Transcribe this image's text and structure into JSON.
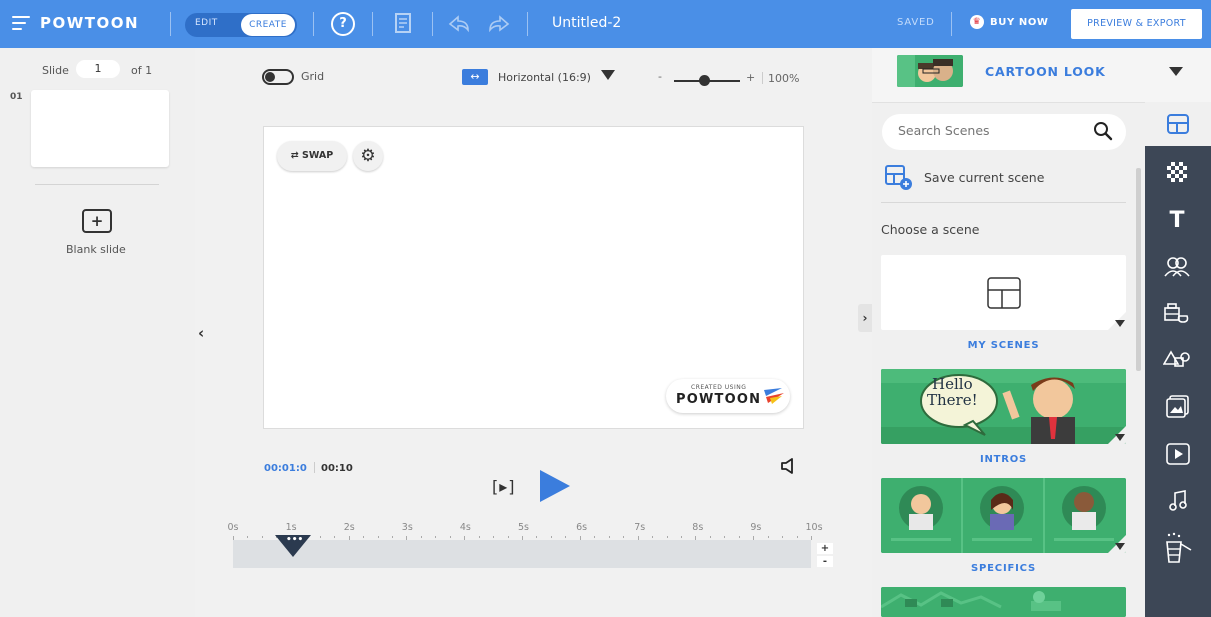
{
  "topbar": {
    "logo": "POWTOON",
    "mode_edit": "EDIT",
    "mode_create": "CREATE",
    "help": "?",
    "doc_title": "Untitled-2",
    "saved": "SAVED",
    "buy_now": "BUY NOW",
    "preview_export": "PREVIEW & EXPORT"
  },
  "slides": {
    "label": "Slide",
    "current": "1",
    "of": "of 1",
    "index": "01",
    "blank_label": "Blank slide"
  },
  "canvas_toolbar": {
    "grid_label": "Grid",
    "orientation": "Horizontal (16:9)",
    "zoom_minus": "-",
    "zoom_plus": "+",
    "zoom_value": "100%",
    "zoom_level": 0.45
  },
  "stage": {
    "swap_label": "SWAP",
    "watermark_small": "CREATED USING",
    "watermark_big": "POWTOON"
  },
  "playback": {
    "current_time": "00:01:0",
    "total_time": "00:10",
    "play_scene": "[▸]",
    "ticks": [
      "0s",
      "1s",
      "2s",
      "3s",
      "4s",
      "5s",
      "6s",
      "7s",
      "8s",
      "9s",
      "10s"
    ],
    "playhead_dots": "•••",
    "zoom_in": "+",
    "zoom_out": "-"
  },
  "right_panel": {
    "look_label": "CARTOON LOOK",
    "search_placeholder": "Search Scenes",
    "save_scene": "Save current scene",
    "choose_scene": "Choose a scene",
    "scenes": [
      "MY SCENES",
      "INTROS",
      "SPECIFICS"
    ],
    "intro_bubble_1": "Hello",
    "intro_bubble_2": "There!"
  },
  "icons": {
    "rail": [
      "scenes-icon",
      "backgrounds-icon",
      "text-icon",
      "characters-icon",
      "props-icon",
      "shapes-icon",
      "media-icon",
      "video-icon",
      "music-icon",
      "specials-icon"
    ]
  },
  "colors": {
    "accent": "#4a8fe7",
    "brand_blue": "#3b7ddd",
    "rail": "#3d4756",
    "scene_green": "#3eaf6f"
  }
}
